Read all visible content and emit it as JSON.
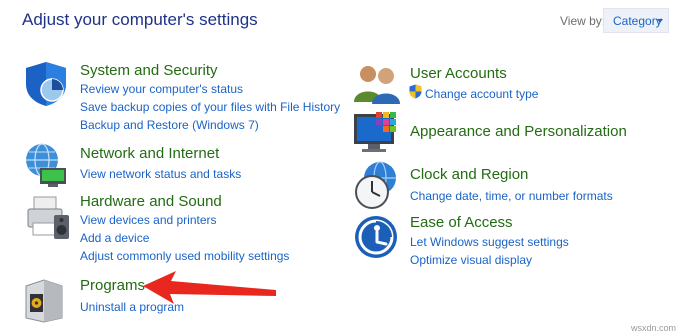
{
  "header": {
    "title": "Adjust your computer's settings",
    "view_by_label": "View by:",
    "view_by_value": "Category"
  },
  "left": {
    "system_security": {
      "title": "System and Security",
      "links": [
        "Review your computer's status",
        "Save backup copies of your files with File History",
        "Backup and Restore (Windows 7)"
      ]
    },
    "network": {
      "title": "Network and Internet",
      "links": [
        "View network status and tasks"
      ]
    },
    "hardware": {
      "title": "Hardware and Sound",
      "links": [
        "View devices and printers",
        "Add a device",
        "Adjust commonly used mobility settings"
      ]
    },
    "programs": {
      "title": "Programs",
      "links": [
        "Uninstall a program"
      ]
    }
  },
  "right": {
    "user_accounts": {
      "title": "User Accounts",
      "links": [
        "Change account type"
      ]
    },
    "appearance": {
      "title": "Appearance and Personalization",
      "links": []
    },
    "clock": {
      "title": "Clock and Region",
      "links": [
        "Change date, time, or number formats"
      ]
    },
    "ease": {
      "title": "Ease of Access",
      "links": [
        "Let Windows suggest settings",
        "Optimize visual display"
      ]
    }
  },
  "annotation": {
    "arrow_color": "#e8281e"
  },
  "watermark": "wsxdn.com",
  "colors": {
    "title_blue": "#1e3287",
    "category_green": "#226c12",
    "link_blue": "#1a64c8"
  }
}
